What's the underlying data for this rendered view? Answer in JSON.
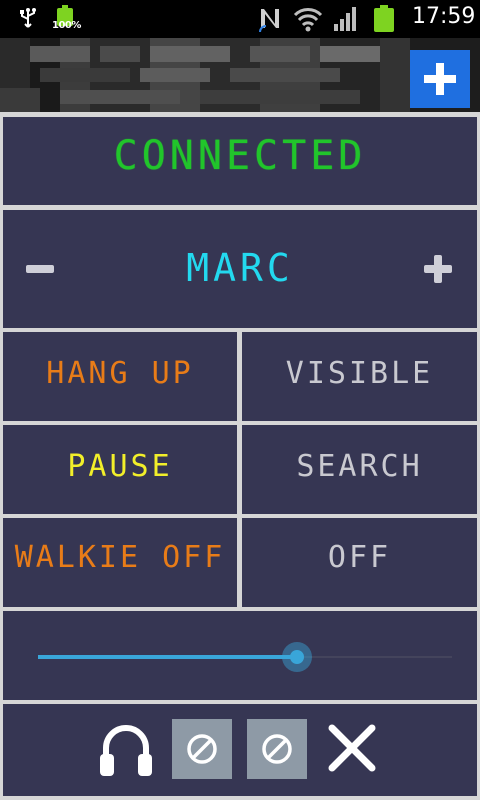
{
  "status_bar": {
    "battery_small_label": "100%",
    "time": "17:59",
    "icons": [
      "usb-icon",
      "battery-icon",
      "nfc-icon",
      "wifi-icon",
      "signal-icon",
      "battery-icon"
    ]
  },
  "ad_banner": {
    "icon": "plus-icon"
  },
  "connection": {
    "status": "CONNECTED",
    "color": "#21c52b"
  },
  "contact": {
    "name": "MARC",
    "prev_icon": "minus-icon",
    "next_icon": "plus-icon",
    "color": "#23d9ef"
  },
  "actions": {
    "hang_up": "HANG UP",
    "visible": "VISIBLE",
    "pause": "PAUSE",
    "search": "SEARCH",
    "walkie": "WALKIE OFF",
    "off": "OFF"
  },
  "volume": {
    "level": 0.63,
    "accent": "#39a6d9"
  },
  "bottom_bar": {
    "icons": [
      "headphones-icon",
      "blocked-icon",
      "blocked-icon",
      "close-icon"
    ]
  }
}
